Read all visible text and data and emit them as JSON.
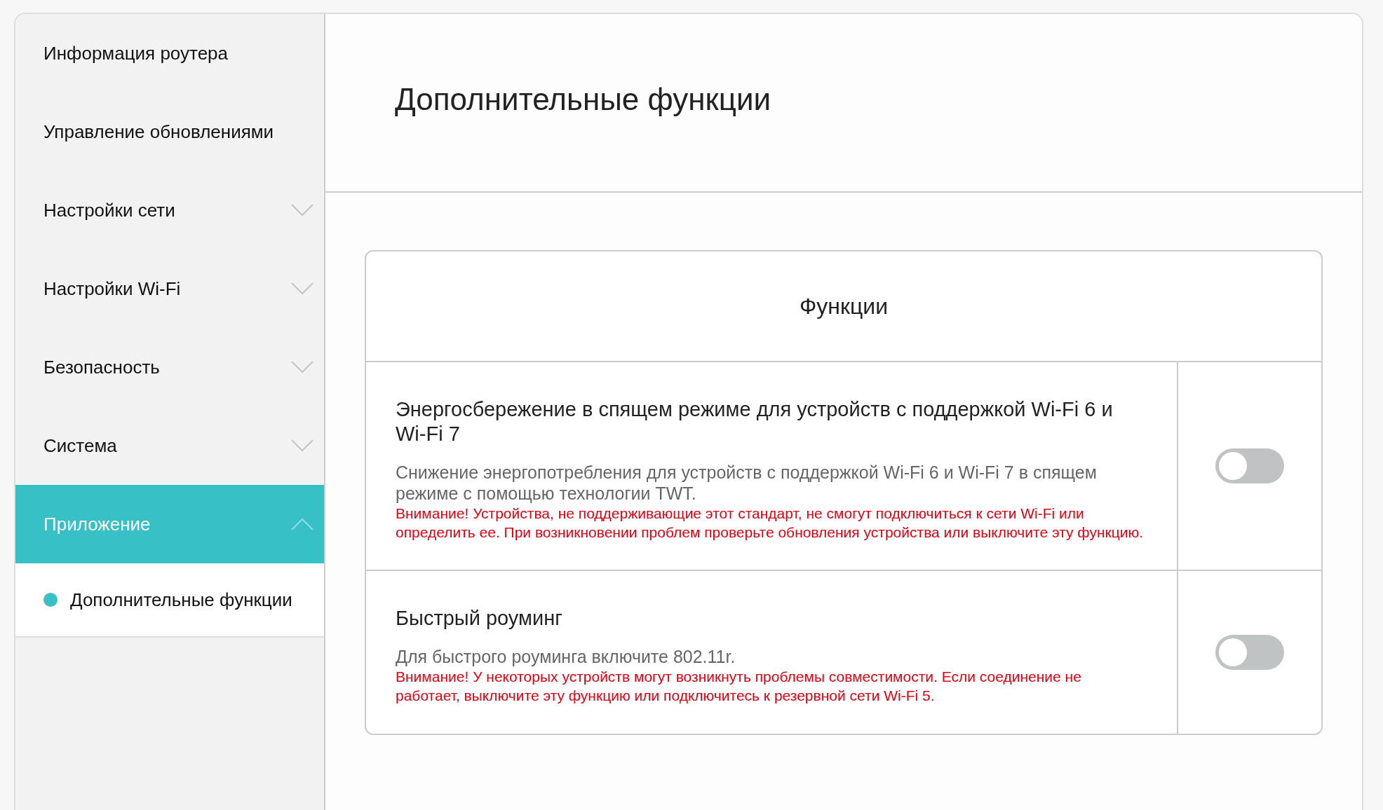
{
  "sidebar": {
    "items": [
      {
        "label": "Информация роутера",
        "kind": "link",
        "selected": false
      },
      {
        "label": "Управление обновлениями",
        "kind": "link",
        "selected": false
      },
      {
        "label": "Настройки сети",
        "kind": "group",
        "expanded": false,
        "selected": false
      },
      {
        "label": "Настройки Wi-Fi",
        "kind": "group",
        "expanded": false,
        "selected": false
      },
      {
        "label": "Безопасность",
        "kind": "group",
        "expanded": false,
        "selected": false
      },
      {
        "label": "Система",
        "kind": "group",
        "expanded": false,
        "selected": false
      },
      {
        "label": "Приложение",
        "kind": "group",
        "expanded": true,
        "selected": true,
        "children": [
          {
            "label": "Дополнительные функции",
            "selected": true
          }
        ]
      }
    ]
  },
  "page": {
    "title": "Дополнительные функции"
  },
  "card": {
    "title": "Функции",
    "features": [
      {
        "title": "Энергосбережение в спящем режиме для устройств с поддержкой Wi-Fi 6 и Wi-Fi 7",
        "description": "Снижение энергопотребления для устройств с поддержкой Wi-Fi 6 и Wi-Fi 7 в спящем режиме с помощью технологии TWT.",
        "warning": "Внимание! Устройства, не поддерживающие этот стандарт, не смогут подключиться к сети Wi-Fi или определить ее. При возникновении проблем проверьте обновления устройства или выключите эту функцию.",
        "on": false
      },
      {
        "title": "Быстрый роуминг",
        "description": "Для быстрого роуминга включите 802.11r.",
        "warning": "Внимание! У некоторых устройств могут возникнуть проблемы совместимости. Если соединение не работает, выключите эту функцию или подключитесь к резервной сети Wi-Fi 5.",
        "on": false
      }
    ]
  }
}
